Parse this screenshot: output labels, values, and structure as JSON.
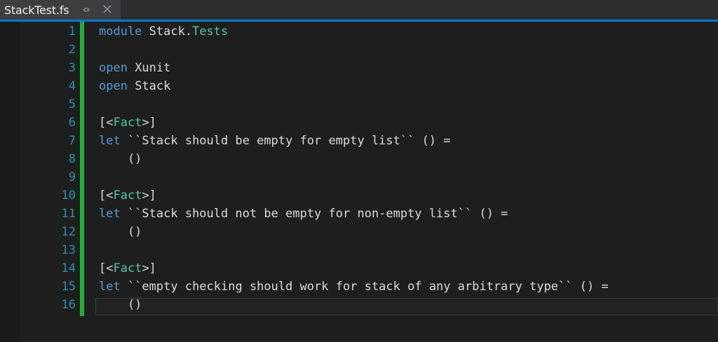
{
  "tab": {
    "title": "StackTest.fs"
  },
  "icons": {
    "pin": "pin-icon",
    "close": "close-icon"
  },
  "colors": {
    "keyword": "#569cd6",
    "type": "#4ec9b0",
    "line_number": "#2b91af",
    "change_bar": "#1fb03c",
    "accent": "#007acc"
  },
  "lines": [
    {
      "n": "1",
      "parts": [
        [
          "kw",
          "module"
        ],
        [
          "pl",
          " Stack."
        ],
        [
          "ty",
          "Tests"
        ]
      ]
    },
    {
      "n": "2",
      "parts": []
    },
    {
      "n": "3",
      "parts": [
        [
          "kw",
          "open"
        ],
        [
          "pl",
          " Xunit"
        ]
      ]
    },
    {
      "n": "4",
      "parts": [
        [
          "kw",
          "open"
        ],
        [
          "pl",
          " Stack"
        ]
      ]
    },
    {
      "n": "5",
      "parts": []
    },
    {
      "n": "6",
      "parts": [
        [
          "pl",
          "[<"
        ],
        [
          "ty",
          "Fact"
        ],
        [
          "pl",
          ">]"
        ]
      ]
    },
    {
      "n": "7",
      "parts": [
        [
          "kw",
          "let"
        ],
        [
          "pl",
          " ``Stack should be empty for empty list`` () ="
        ]
      ]
    },
    {
      "n": "8",
      "parts": [
        [
          "pl",
          "    ()"
        ]
      ]
    },
    {
      "n": "9",
      "parts": []
    },
    {
      "n": "10",
      "parts": [
        [
          "pl",
          "[<"
        ],
        [
          "ty",
          "Fact"
        ],
        [
          "pl",
          ">]"
        ]
      ]
    },
    {
      "n": "11",
      "parts": [
        [
          "kw",
          "let"
        ],
        [
          "pl",
          " ``Stack should not be empty for non-empty list`` () ="
        ]
      ]
    },
    {
      "n": "12",
      "parts": [
        [
          "pl",
          "    ()"
        ]
      ]
    },
    {
      "n": "13",
      "parts": []
    },
    {
      "n": "14",
      "parts": [
        [
          "pl",
          "[<"
        ],
        [
          "ty",
          "Fact"
        ],
        [
          "pl",
          ">]"
        ]
      ]
    },
    {
      "n": "15",
      "parts": [
        [
          "kw",
          "let"
        ],
        [
          "pl",
          " ``empty checking should work for stack of any arbitrary type`` () ="
        ]
      ]
    },
    {
      "n": "16",
      "parts": [
        [
          "pl",
          "    ()"
        ]
      ]
    }
  ]
}
